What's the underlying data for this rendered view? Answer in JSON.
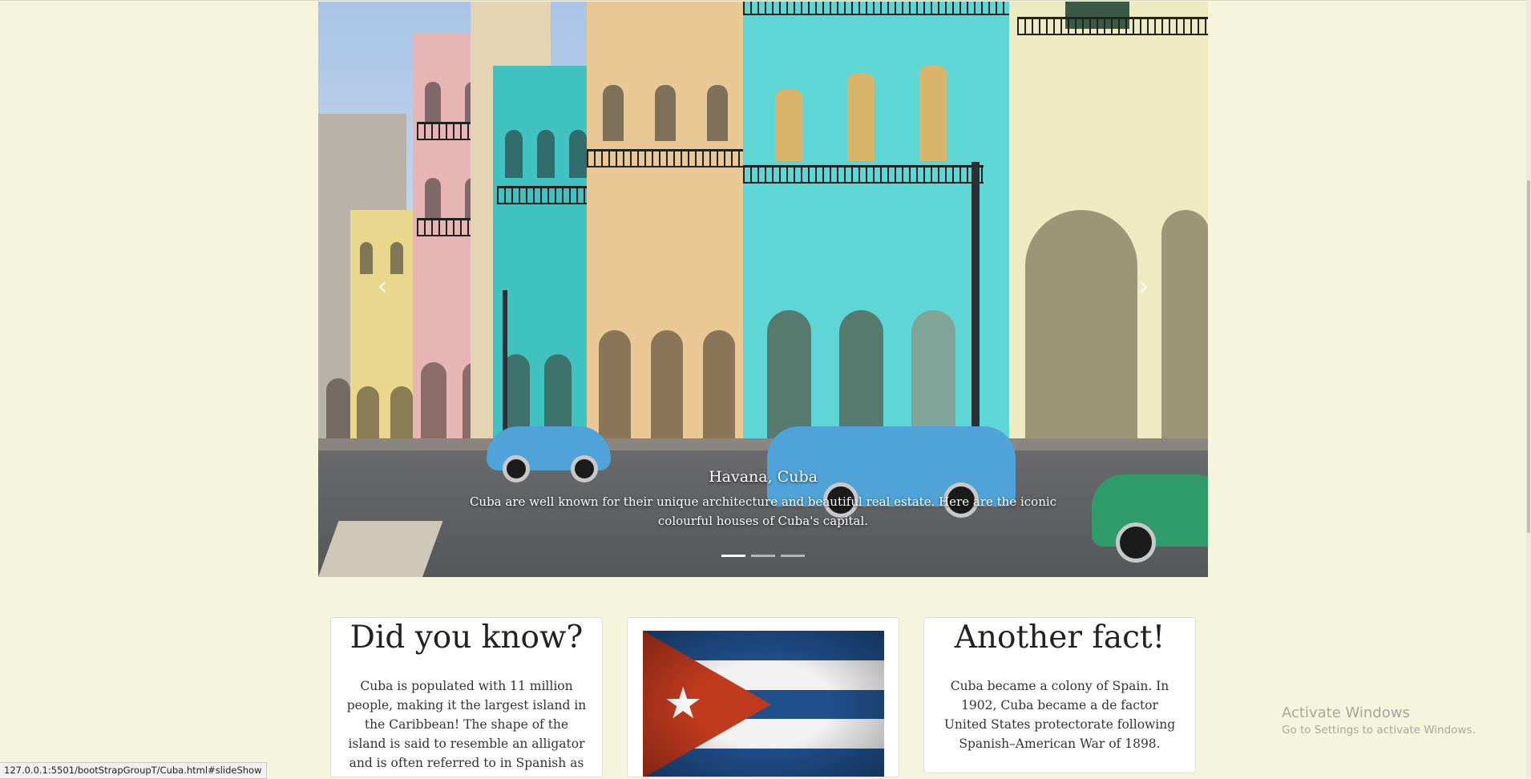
{
  "carousel": {
    "caption_title": "Havana, Cuba",
    "caption_text": "Cuba are well known for their unique architecture and beautiful real estate. Here are the iconic colourful houses of Cuba's capital.",
    "prev_icon": "chevron-left-icon",
    "next_icon": "chevron-right-icon",
    "prev_glyph": "‹",
    "next_glyph": "›",
    "active_slide": 1,
    "slide_count": 3
  },
  "cards": [
    {
      "title": "Did you know?",
      "text": "Cuba is populated with 11 million people, making it the largest island in the Caribbean! The shape of the island is said to resemble an alligator and is often referred to in Spanish as \"El Cocodrilo\" or"
    },
    {
      "image": "cuba-flag-image",
      "star_glyph": "★"
    },
    {
      "title": "Another fact!",
      "text": "Cuba became a colony of Spain. In 1902, Cuba became a de factor United States protectorate following Spanish–American War of 1898."
    }
  ],
  "watermark": {
    "line1": "Activate Windows",
    "line2": "Go to Settings to activate Windows."
  },
  "status_url": "127.0.0.1:5501/bootStrapGroupT/Cuba.html#slideShow",
  "colors": {
    "page_bg": "#f5f4dc",
    "flag_red": "#c23a1e",
    "flag_blue": "#1f4f8c",
    "car_blue": "#4fa3d8"
  }
}
